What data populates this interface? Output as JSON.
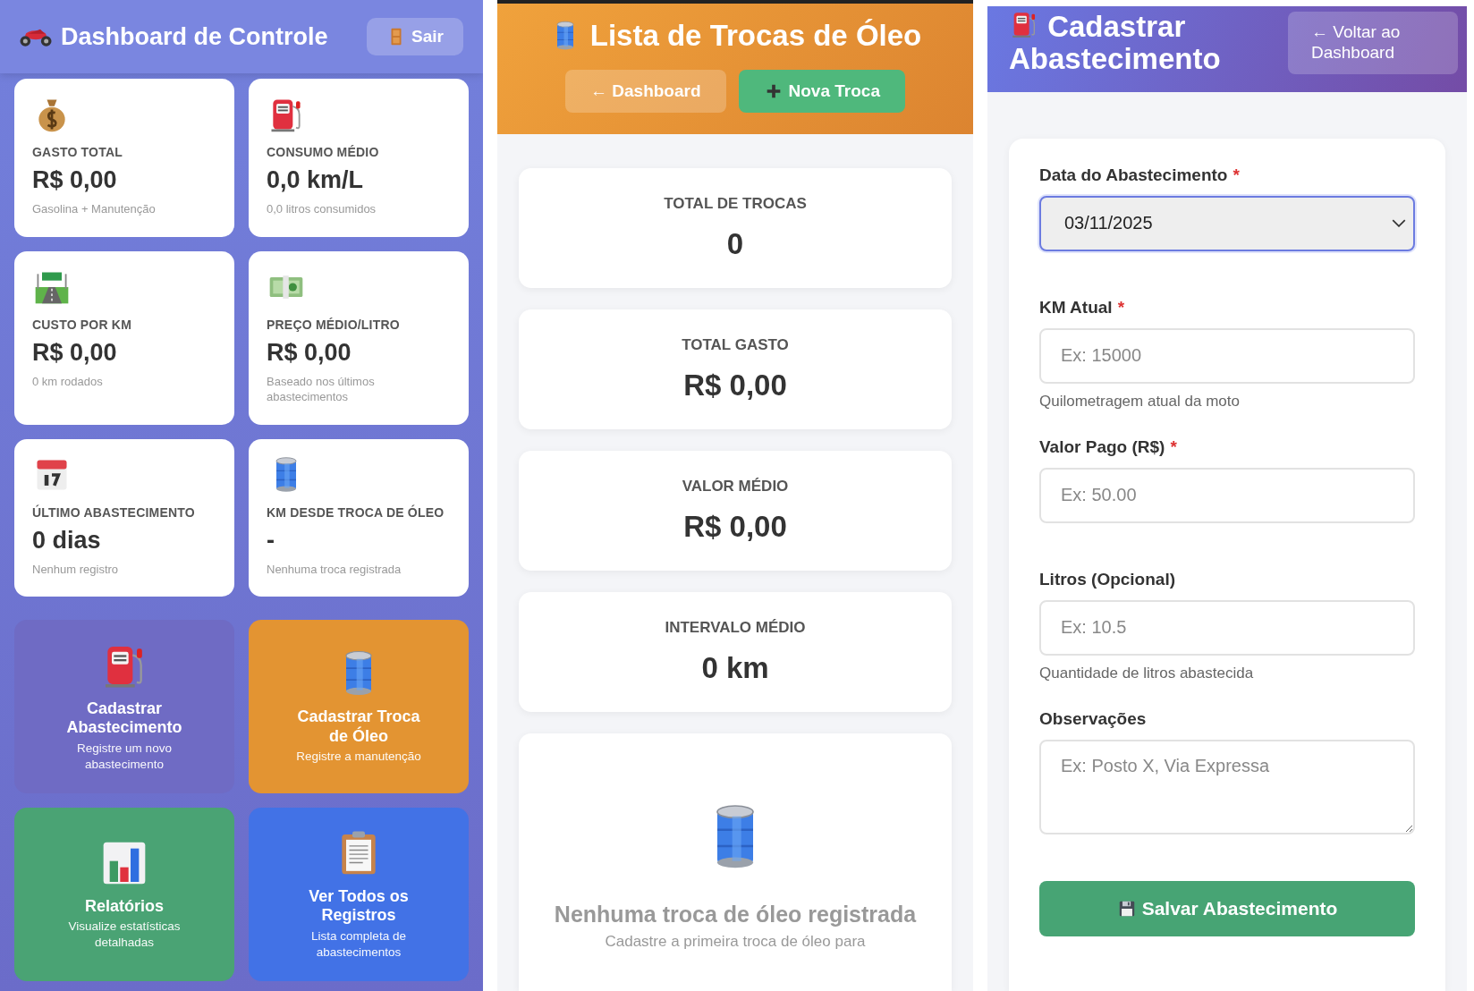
{
  "dashboard": {
    "title": "Dashboard de Controle",
    "logout_button": "Sair",
    "stats": [
      {
        "label": "GASTO TOTAL",
        "value": "R$ 0,00",
        "note": "Gasolina + Manutenção"
      },
      {
        "label": "CONSUMO MÉDIO",
        "value": "0,0 km/L",
        "note": "0,0 litros consumidos"
      },
      {
        "label": "CUSTO POR KM",
        "value": "R$ 0,00",
        "note": "0 km rodados"
      },
      {
        "label": "PREÇO MÉDIO/LITRO",
        "value": "R$ 0,00",
        "note": "Baseado nos últimos abastecimentos"
      },
      {
        "label": "ÚLTIMO ABASTECIMENTO",
        "value": "0 dias",
        "note": "Nenhum registro"
      },
      {
        "label": "KM DESDE TROCA DE ÓLEO",
        "value": "-",
        "note": "Nenhuma troca registrada"
      }
    ],
    "actions": [
      {
        "title": "Cadastrar Abastecimento",
        "subtitle": "Registre um novo abastecimento",
        "color": "#6f6bc4"
      },
      {
        "title": "Cadastrar Troca de Óleo",
        "subtitle": "Registre a manutenção",
        "color": "#e39432"
      },
      {
        "title": "Relatórios",
        "subtitle": "Visualize estatísticas detalhadas",
        "color": "#4aa374"
      },
      {
        "title": "Ver Todos os Registros",
        "subtitle": "Lista completa de abastecimentos",
        "color": "#4272e6"
      }
    ]
  },
  "oil_changes": {
    "title": "Lista de Trocas de Óleo",
    "buttons": [
      {
        "label": "← Dashboard",
        "kind": "secondary"
      },
      {
        "label": "Nova Troca",
        "kind": "primary"
      }
    ],
    "stats": [
      {
        "label": "TOTAL DE TROCAS",
        "value": "0"
      },
      {
        "label": "TOTAL GASTO",
        "value": "R$ 0,00"
      },
      {
        "label": "VALOR MÉDIO",
        "value": "R$ 0,00"
      },
      {
        "label": "INTERVALO MÉDIO",
        "value": "0 km"
      }
    ],
    "empty_state": {
      "title": "Nenhuma troca de óleo registrada",
      "subtitle": "Cadastre a primeira troca de óleo para"
    }
  },
  "fuel_form": {
    "title": "Cadastrar Abastecimento",
    "back_button": "← Voltar ao Dashboard",
    "fields": [
      {
        "kind": "select",
        "label": "Data do Abastecimento",
        "required_mark": "*",
        "value": "03/11/2025",
        "focused": true
      },
      {
        "kind": "input",
        "label": "KM Atual",
        "required_mark": "*",
        "placeholder": "Ex: 15000",
        "hint": "Quilometragem atual da moto",
        "focused": false
      },
      {
        "kind": "input",
        "label": "Valor Pago (R$)",
        "required_mark": "*",
        "placeholder": "Ex: 50.00",
        "focused": false
      },
      {
        "kind": "input",
        "label": "Litros (Opcional)",
        "placeholder": "Ex: 10.5",
        "hint": "Quantidade de litros abastecida",
        "focused": false
      },
      {
        "kind": "textarea",
        "label": "Observações",
        "placeholder": "Ex: Posto X, Via Expressa",
        "focused": false
      }
    ],
    "submit_button": "Salvar Abastecimento"
  }
}
